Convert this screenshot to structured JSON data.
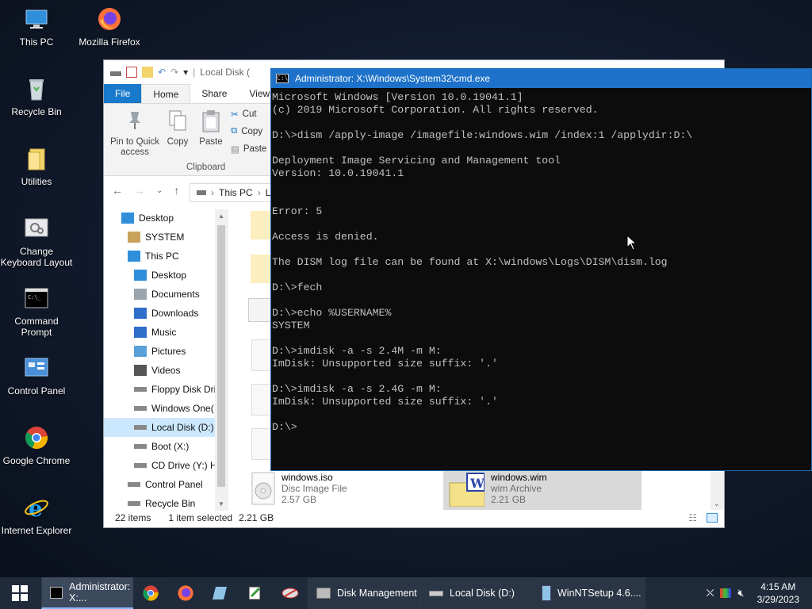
{
  "desktop": {
    "icons": [
      {
        "label": "This PC",
        "icon": "this-pc-icon"
      },
      {
        "label": "Mozilla Firefox",
        "icon": "firefox-icon"
      },
      {
        "label": "Recycle Bin",
        "icon": "recycle-bin-icon"
      },
      {
        "label": "Utilities",
        "icon": "folder-icon"
      },
      {
        "label": "Change Keyboard Layout",
        "icon": "keyboard-layout-icon"
      },
      {
        "label": "Command Prompt",
        "icon": "command-prompt-icon"
      },
      {
        "label": "Control Panel",
        "icon": "control-panel-icon"
      },
      {
        "label": "Google Chrome",
        "icon": "chrome-icon"
      },
      {
        "label": "Internet Explorer",
        "icon": "internet-explorer-icon"
      }
    ]
  },
  "explorer": {
    "title": "Local Disk (",
    "tabs": {
      "file": "File",
      "home": "Home",
      "share": "Share",
      "view": "View"
    },
    "ribbon": {
      "pin": "Pin to Quick access",
      "copy": "Copy",
      "paste": "Paste",
      "cut": "Cut",
      "copy_path": "Copy",
      "paste_shortcut": "Paste",
      "group": "Clipboard"
    },
    "address": {
      "crumb": "This PC",
      "rest": "L"
    },
    "nav": [
      {
        "label": "Desktop",
        "indent": 22
      },
      {
        "label": "SYSTEM",
        "indent": 30
      },
      {
        "label": "This PC",
        "indent": 30
      },
      {
        "label": "Desktop",
        "indent": 38
      },
      {
        "label": "Documents",
        "indent": 38
      },
      {
        "label": "Downloads",
        "indent": 38
      },
      {
        "label": "Music",
        "indent": 38
      },
      {
        "label": "Pictures",
        "indent": 38
      },
      {
        "label": "Videos",
        "indent": 38
      },
      {
        "label": "Floppy Disk Dri",
        "indent": 38
      },
      {
        "label": "Windows One(",
        "indent": 38
      },
      {
        "label": "Local Disk (D:)",
        "indent": 38,
        "selected": true
      },
      {
        "label": "Boot (X:)",
        "indent": 38
      },
      {
        "label": "CD Drive (Y:) H",
        "indent": 38
      },
      {
        "label": "Control Panel",
        "indent": 30
      },
      {
        "label": "Recycle Bin",
        "indent": 30
      }
    ],
    "files": [
      {
        "name": "windows.iso",
        "type": "Disc Image File",
        "size": "2.57 GB"
      },
      {
        "name": "windows.wim",
        "type": "wim Archive",
        "size": "2.21 GB"
      }
    ],
    "status": {
      "items": "22 items",
      "selected": "1 item selected",
      "size": "2.21 GB"
    }
  },
  "cmd": {
    "title": "Administrator: X:\\Windows\\System32\\cmd.exe",
    "lines": [
      "Microsoft Windows [Version 10.0.19041.1]",
      "(c) 2019 Microsoft Corporation. All rights reserved.",
      "",
      "D:\\>dism /apply-image /imagefile:windows.wim /index:1 /applydir:D:\\",
      "",
      "Deployment Image Servicing and Management tool",
      "Version: 10.0.19041.1",
      "",
      "",
      "Error: 5",
      "",
      "Access is denied.",
      "",
      "The DISM log file can be found at X:\\windows\\Logs\\DISM\\dism.log",
      "",
      "D:\\>fech",
      "",
      "D:\\>echo %USERNAME%",
      "SYSTEM",
      "",
      "D:\\>imdisk -a -s 2.4M -m M:",
      "ImDisk: Unsupported size suffix: '.'",
      "",
      "D:\\>imdisk -a -s 2.4G -m M:",
      "ImDisk: Unsupported size suffix: '.'",
      "",
      "D:\\>"
    ]
  },
  "taskbar": {
    "cmd": "Administrator: X:...",
    "disk_mgmt": "Disk Management",
    "local_disk": "Local Disk (D:)",
    "winntsetup": "WinNTSetup 4.6....",
    "time": "4:15 AM",
    "date": "3/29/2023"
  },
  "colors": {
    "accent": "#1979ca",
    "cmd_title": "#1e72c9",
    "console_text": "#c0c0c0",
    "selection": "#cce8ff"
  }
}
